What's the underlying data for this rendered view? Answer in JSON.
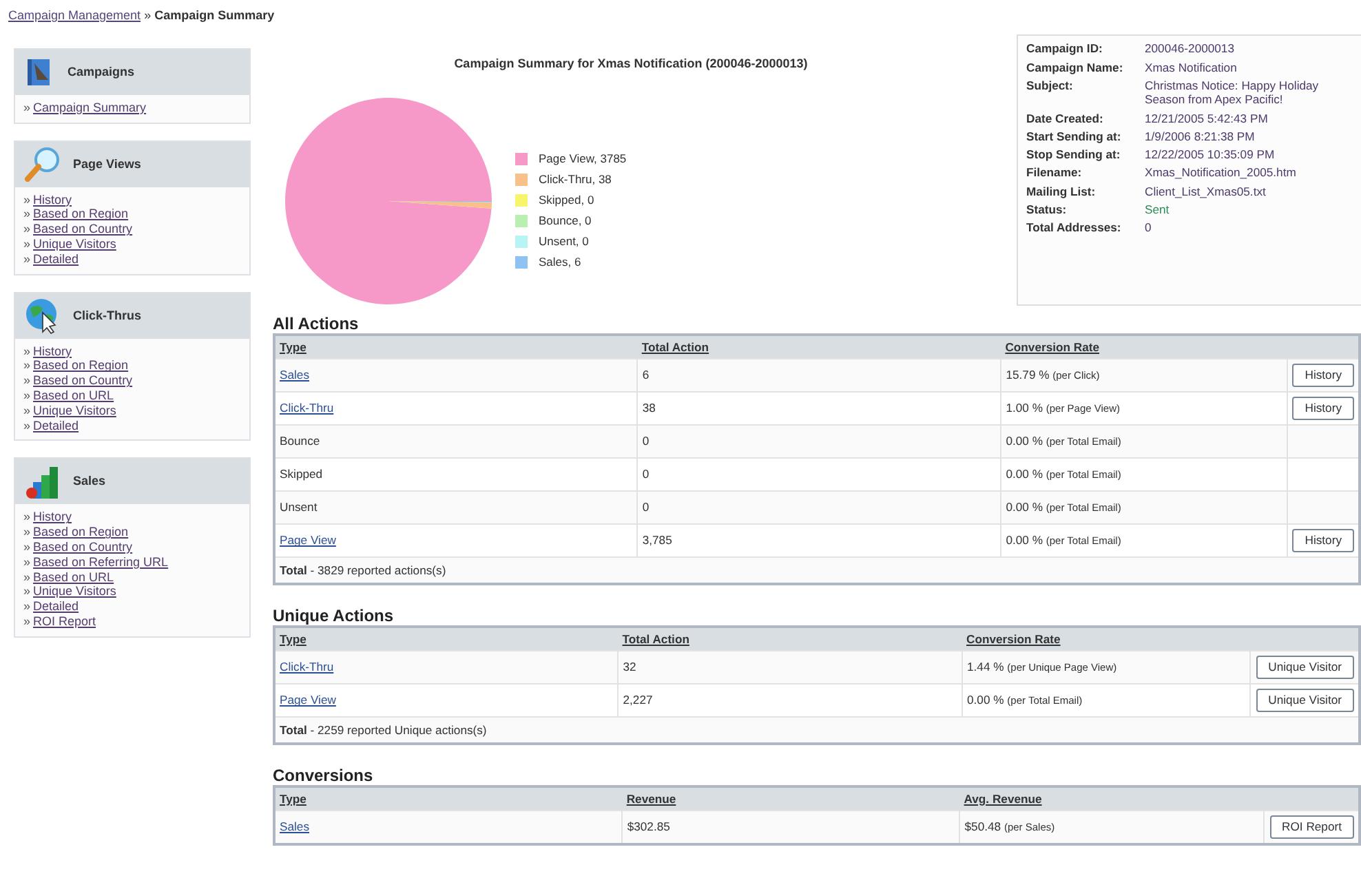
{
  "breadcrumb": {
    "link": "Campaign Management",
    "separator": "»",
    "current": "Campaign Summary"
  },
  "sidebar": [
    {
      "kind": "campaigns",
      "title": "Campaigns",
      "links": [
        "Campaign Summary"
      ]
    },
    {
      "kind": "page_views",
      "title": "Page Views",
      "links": [
        "History",
        "Based on Region",
        "Based on Country",
        "Unique Visitors",
        "Detailed"
      ]
    },
    {
      "kind": "click_thrus",
      "title": "Click-Thrus",
      "links": [
        "History",
        "Based on Region",
        "Based on Country",
        "Based on URL",
        "Unique Visitors",
        "Detailed"
      ]
    },
    {
      "kind": "sales",
      "title": "Sales",
      "links": [
        "History",
        "Based on Region",
        "Based on Country",
        "Based on Referring URL",
        "Based on URL",
        "Unique Visitors",
        "Detailed",
        "ROI Report"
      ]
    }
  ],
  "chart": {
    "chart_data": {
      "type": "pie",
      "title": "Campaign Summary for Xmas Notification (200046-2000013)",
      "categories": [
        "Page View, 3785",
        "Click-Thru, 38",
        "Skipped, 0",
        "Bounce, 0",
        "Unsent, 0",
        "Sales, 6"
      ],
      "values": [
        3785,
        38,
        0,
        0,
        0,
        6
      ],
      "legend": "right"
    },
    "legend": [
      {
        "color": "#f799c8"
      },
      {
        "color": "#f9c08a"
      },
      {
        "color": "#f7f56e"
      },
      {
        "color": "#b8f0b0"
      },
      {
        "color": "#b8f4f4"
      },
      {
        "color": "#8ec2f2"
      }
    ]
  },
  "bullet": "»",
  "info": [
    {
      "kind": "plain",
      "label": "Campaign ID:",
      "value": "200046-2000013"
    },
    {
      "kind": "plain",
      "label": "Campaign Name:",
      "value": "Xmas Notification"
    },
    {
      "kind": "plain",
      "label": "Subject:",
      "value": "Christmas Notice: Happy Holiday Season from Apex Pacific!"
    },
    {
      "kind": "plain",
      "label": "Date Created:",
      "value": "12/21/2005 5:42:43 PM"
    },
    {
      "kind": "plain",
      "label": "Start Sending at:",
      "value": "1/9/2006 8:21:38 PM"
    },
    {
      "kind": "plain",
      "label": "Stop Sending at:",
      "value": "12/22/2005 10:35:09 PM"
    },
    {
      "kind": "plain",
      "label": "Filename:",
      "value": "Xmas_Notification_2005.htm"
    },
    {
      "kind": "plain",
      "label": "Mailing List:",
      "value": "Client_List_Xmas05.txt"
    },
    {
      "kind": "status",
      "label": "Status:",
      "value": "Sent"
    },
    {
      "kind": "plain",
      "label": "Total Addresses:",
      "value": "0"
    }
  ],
  "tables": [
    {
      "title": "All Actions",
      "columns": [
        "Type",
        "Total Action",
        "Conversion Rate"
      ],
      "rows": [
        {
          "cells": [
            {
              "text": "Sales",
              "link": true
            },
            {
              "text": "6"
            },
            {
              "text": "15.79 %",
              "note": "(per Click)"
            }
          ],
          "button": "History"
        },
        {
          "cells": [
            {
              "text": "Click-Thru",
              "link": true
            },
            {
              "text": "38"
            },
            {
              "text": "1.00 %",
              "note": "(per Page View)"
            }
          ],
          "button": "History"
        },
        {
          "cells": [
            {
              "text": "Bounce",
              "link": false
            },
            {
              "text": "0"
            },
            {
              "text": "0.00 %",
              "note": "(per Total Email)"
            }
          ]
        },
        {
          "cells": [
            {
              "text": "Skipped",
              "link": false
            },
            {
              "text": "0"
            },
            {
              "text": "0.00 %",
              "note": "(per Total Email)"
            }
          ]
        },
        {
          "cells": [
            {
              "text": "Unsent",
              "link": false
            },
            {
              "text": "0"
            },
            {
              "text": "0.00 %",
              "note": "(per Total Email)"
            }
          ]
        },
        {
          "cells": [
            {
              "text": "Page View",
              "link": true
            },
            {
              "text": "3,785"
            },
            {
              "text": "0.00 %",
              "note": "(per Total Email)"
            }
          ],
          "button": "History"
        }
      ],
      "total": "**Total** - 3829 reported actions(s)"
    },
    {
      "title": "Unique Actions",
      "columns": [
        "Type",
        "Total Action",
        "Conversion Rate"
      ],
      "rows": [
        {
          "cells": [
            {
              "text": "Click-Thru",
              "link": true
            },
            {
              "text": "32"
            },
            {
              "text": "1.44 %",
              "note": "(per Unique Page View)"
            }
          ],
          "button": "Unique Visitor"
        },
        {
          "cells": [
            {
              "text": "Page View",
              "link": true
            },
            {
              "text": "2,227"
            },
            {
              "text": "0.00 %",
              "note": "(per Total Email)"
            }
          ],
          "button": "Unique Visitor"
        }
      ],
      "total": "**Total** - 2259 reported Unique actions(s)"
    },
    {
      "title": "Conversions",
      "columns": [
        "Type",
        "Revenue",
        "Avg. Revenue"
      ],
      "rows": [
        {
          "cells": [
            {
              "text": "Sales",
              "link": true
            },
            {
              "text": "$302.85"
            },
            {
              "text": "$50.48",
              "note": "(per Sales)"
            }
          ],
          "button": "ROI Report"
        }
      ]
    }
  ]
}
